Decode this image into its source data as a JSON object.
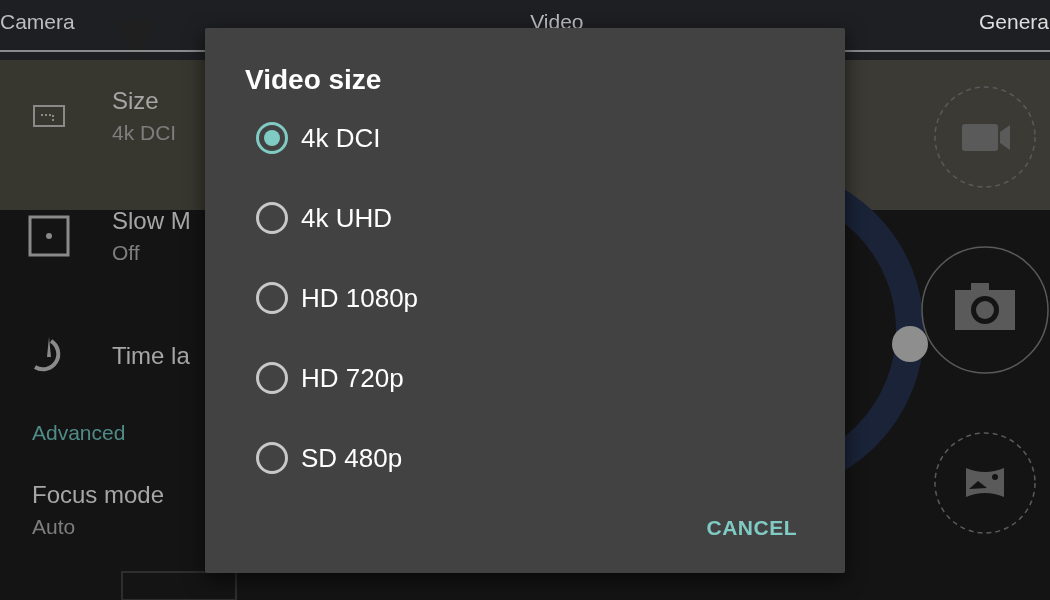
{
  "tabs": [
    {
      "label": "Camera"
    },
    {
      "label": "Video"
    },
    {
      "label": "Genera"
    }
  ],
  "settings": [
    {
      "kind": "item",
      "title": "Size",
      "value": "4k DCI"
    },
    {
      "kind": "item",
      "title": "Slow M",
      "value": "Off"
    },
    {
      "kind": "item",
      "title": "Time la"
    },
    {
      "kind": "header",
      "title": "Advanced"
    },
    {
      "kind": "item",
      "title": "Focus mode",
      "value": "Auto"
    }
  ],
  "dialog": {
    "title": "Video size",
    "options": [
      {
        "label": "4k DCI",
        "selected": true
      },
      {
        "label": "4k UHD",
        "selected": false
      },
      {
        "label": "HD 1080p",
        "selected": false
      },
      {
        "label": "HD 720p",
        "selected": false
      },
      {
        "label": "SD 480p",
        "selected": false
      }
    ],
    "buttons": [
      "CANCEL"
    ]
  }
}
